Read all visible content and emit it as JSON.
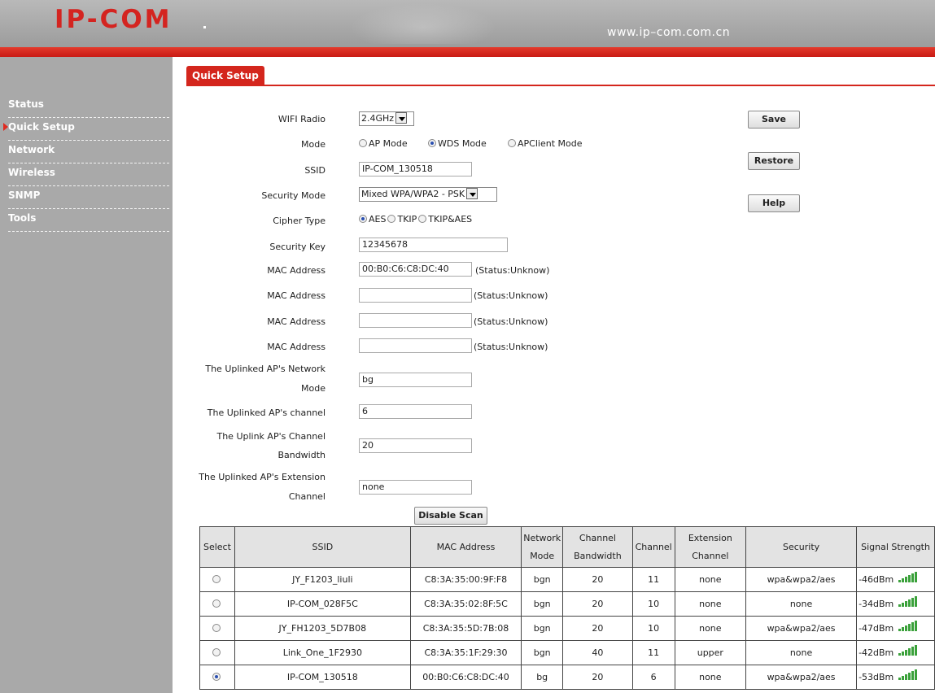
{
  "header": {
    "logo": "IP-COM",
    "url": "www.ip–com.com.cn"
  },
  "sidebar": {
    "items": [
      {
        "label": "Status"
      },
      {
        "label": "Quick Setup"
      },
      {
        "label": "Network"
      },
      {
        "label": "Wireless"
      },
      {
        "label": "SNMP"
      },
      {
        "label": "Tools"
      }
    ]
  },
  "tab": {
    "label": "Quick Setup"
  },
  "form": {
    "wifi_radio_label": "WIFI Radio",
    "wifi_radio_value": "2.4GHz",
    "mode_label": "Mode",
    "mode_options": [
      "AP Mode",
      "WDS Mode",
      "APClient Mode"
    ],
    "ssid_label": "SSID",
    "ssid_value": "IP-COM_130518",
    "security_mode_label": "Security Mode",
    "security_mode_value": "Mixed WPA/WPA2 - PSK",
    "cipher_label": "Cipher Type",
    "cipher_options": [
      "AES",
      "TKIP",
      "TKIP&AES"
    ],
    "key_label": "Security Key",
    "key_value": "12345678",
    "mac_label": "MAC Address",
    "mac1_value": "00:B0:C6:C8:DC:40",
    "mac_status": "(Status:Unknow)",
    "uplink_mode_label_1": "The Uplinked AP's Network",
    "uplink_mode_label_2": "Mode",
    "uplink_mode_value": "bg",
    "uplink_channel_label": "The Uplinked AP's channel",
    "uplink_channel_value": "6",
    "uplink_bw_label_1": "The Uplink AP's Channel",
    "uplink_bw_label_2": "Bandwidth",
    "uplink_bw_value": "20",
    "uplink_ext_label_1": "The Uplinked AP's Extension",
    "uplink_ext_label_2": "Channel",
    "uplink_ext_value": "none"
  },
  "buttons": {
    "save": "Save",
    "restore": "Restore",
    "help": "Help",
    "disable_scan": "Disable Scan"
  },
  "table": {
    "headers": {
      "select": "Select",
      "ssid": "SSID",
      "mac": "MAC Address",
      "mode_1": "Network",
      "mode_2": "Mode",
      "bw_1": "Channel",
      "bw_2": "Bandwidth",
      "channel": "Channel",
      "ext_1": "Extension",
      "ext_2": "Channel",
      "security": "Security",
      "signal": "Signal Strength"
    },
    "rows": [
      {
        "ssid": "JY_F1203_liuli",
        "mac": "C8:3A:35:00:9F:F8",
        "mode": "bgn",
        "bw": "20",
        "channel": "11",
        "ext": "none",
        "security": "wpa&wpa2/aes",
        "signal": "-46dBm",
        "selected": false
      },
      {
        "ssid": "IP-COM_028F5C",
        "mac": "C8:3A:35:02:8F:5C",
        "mode": "bgn",
        "bw": "20",
        "channel": "10",
        "ext": "none",
        "security": "none",
        "signal": "-34dBm",
        "selected": false
      },
      {
        "ssid": "JY_FH1203_5D7B08",
        "mac": "C8:3A:35:5D:7B:08",
        "mode": "bgn",
        "bw": "20",
        "channel": "10",
        "ext": "none",
        "security": "wpa&wpa2/aes",
        "signal": "-47dBm",
        "selected": false
      },
      {
        "ssid": "Link_One_1F2930",
        "mac": "C8:3A:35:1F:29:30",
        "mode": "bgn",
        "bw": "40",
        "channel": "11",
        "ext": "upper",
        "security": "none",
        "signal": "-42dBm",
        "selected": false
      },
      {
        "ssid": "IP-COM_130518",
        "mac": "00:B0:C6:C8:DC:40",
        "mode": "bg",
        "bw": "20",
        "channel": "6",
        "ext": "none",
        "security": "wpa&wpa2/aes",
        "signal": "-53dBm",
        "selected": true
      }
    ]
  }
}
